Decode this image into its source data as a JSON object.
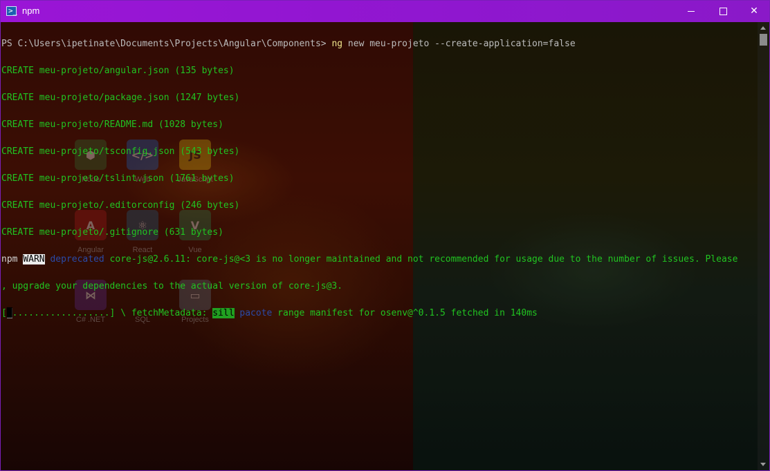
{
  "window": {
    "title": "npm",
    "icon": "powershell-icon",
    "controls": {
      "minimize": "minimize-icon",
      "maximize": "maximize-icon",
      "close": "✕"
    }
  },
  "colors": {
    "titlebar": "#9a15d6",
    "create_text": "#21c321",
    "command": "#f0e68c",
    "deprecated": "#2a4aa8",
    "progress_badge": "#21a021"
  },
  "desktop_icons": [
    {
      "label": "Node"
    },
    {
      "label": "Web"
    },
    {
      "label": "JavaScript"
    },
    {
      "label": "Angular"
    },
    {
      "label": "React"
    },
    {
      "label": "Vue"
    },
    {
      "label": "C# .NET"
    },
    {
      "label": "SQL"
    },
    {
      "label": "Projects"
    }
  ],
  "console": {
    "prompt": "PS C:\\Users\\ipetinate\\Documents\\Projects\\Angular\\Components> ",
    "command_ng": "ng",
    "command_rest": " new meu-projeto --create-application=false",
    "create_lines": [
      "CREATE meu-projeto/angular.json (135 bytes)",
      "CREATE meu-projeto/package.json (1247 bytes)",
      "CREATE meu-projeto/README.md (1028 bytes)",
      "CREATE meu-projeto/tsconfig.json (543 bytes)",
      "CREATE meu-projeto/tslint.json (1761 bytes)",
      "CREATE meu-projeto/.editorconfig (246 bytes)",
      "CREATE meu-projeto/.gitignore (631 bytes)"
    ],
    "warn": {
      "npm": "npm ",
      "badge": "WARN",
      "deprecated": " deprecated",
      "message1": " core-js@2.6.11: core-js@<3 is no longer maintained and not recommended for usage due to the number of issues. Please",
      "message2": ", upgrade your dependencies to the actual version of core-js@3."
    },
    "progress": {
      "open": "[",
      "cursor": "█",
      "dots": "..................] \\ fetchMetadata: ",
      "sill": "sill",
      "pacote": " pacote",
      "rest": " range manifest for osenv@^0.1.5 fetched in 140ms"
    }
  }
}
